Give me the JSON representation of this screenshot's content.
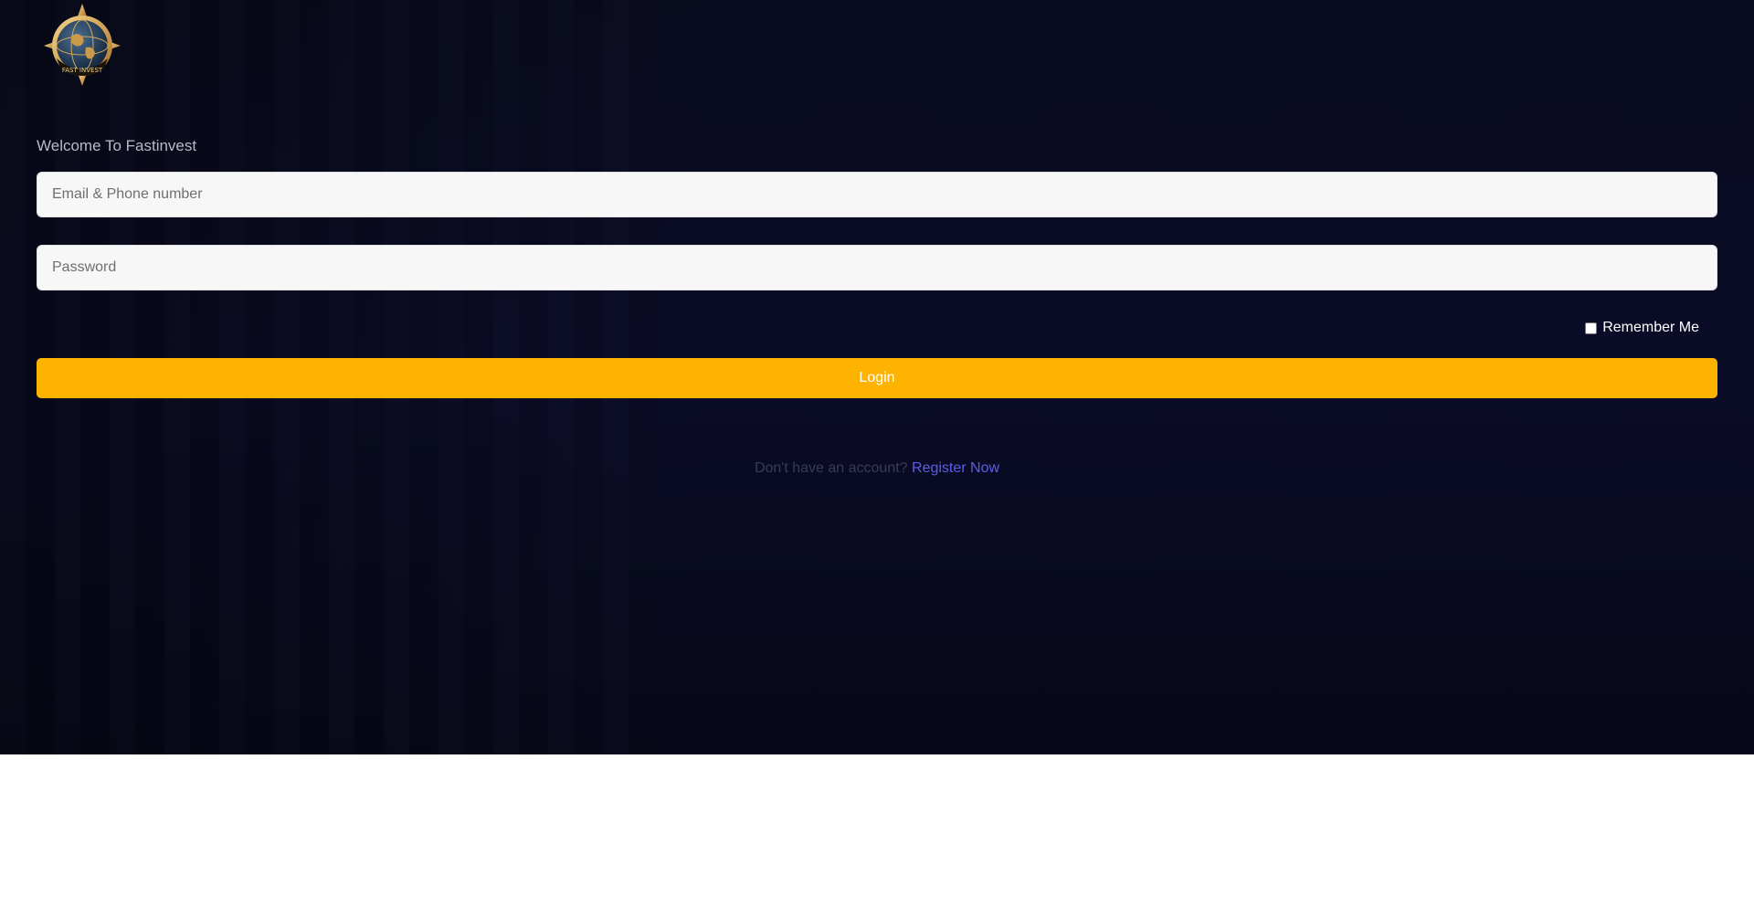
{
  "brand": {
    "logo_icon": "globe-compass-emblem-icon",
    "logo_text": "FAST INVEST"
  },
  "form": {
    "welcome": "Welcome To Fastinvest",
    "email_placeholder": "Email & Phone number",
    "password_placeholder": "Password",
    "remember_label": "Remember Me",
    "login_label": "Login"
  },
  "footer": {
    "no_account_text": "Don't have an account?",
    "register_label": "Register Now"
  },
  "colors": {
    "background": "#0a0b27",
    "accent": "#feb301",
    "link": "#5b5fe8"
  }
}
